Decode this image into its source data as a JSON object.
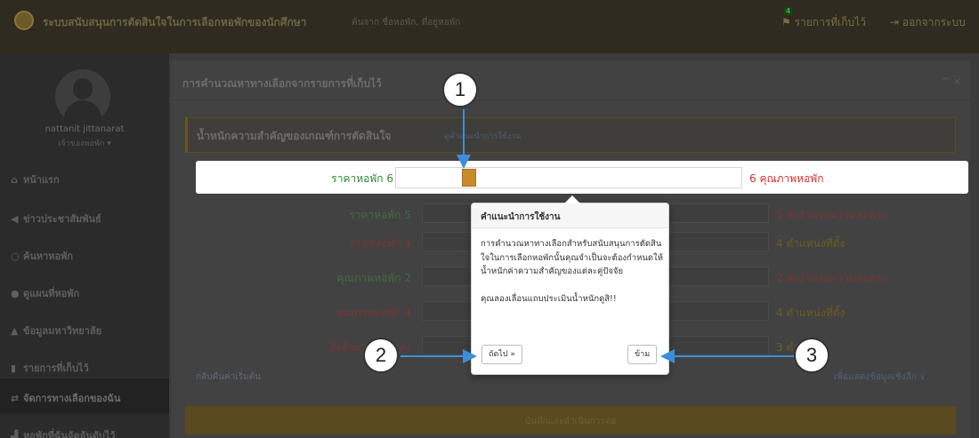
{
  "header": {
    "title": "ระบบสนับสนุนการตัดสินใจในการเลือกหอพักของนักศึกษา",
    "subtitle": "ค้นจาก ชื่อหอพัก, ที่อยู่หอพัก",
    "saved_count": "4",
    "saved_label": "รายการที่เก็บไว้",
    "logout_label": "ออกจากระบบ"
  },
  "sidebar": {
    "user_name": "nattanit jittanarat",
    "user_role": "เจ้าของหอพัก ▾",
    "items": [
      {
        "label": "หน้าแรก",
        "icon": "home-icon"
      },
      {
        "label": "ข่าวประชาสัมพันธ์",
        "icon": "megaphone-icon"
      },
      {
        "label": "ค้นหาหอพัก",
        "icon": "search-icon"
      },
      {
        "label": "ดูแผนที่หอพัก",
        "icon": "map-marker-icon"
      },
      {
        "label": "ข้อมูลมหาวิทยาลัย",
        "icon": "graduation-cap-icon"
      },
      {
        "label": "รายการที่เก็บไว้",
        "icon": "bookmark-icon"
      },
      {
        "label": "จัดการทางเลือกของฉัน",
        "icon": "exchange-icon"
      },
      {
        "label": "หอพักที่ฉันจัดอันดับไว้",
        "icon": "bar-chart-icon"
      }
    ]
  },
  "panel": {
    "title": "การคำนวณหาทางเลือกจากรายการที่เก็บไว้",
    "controls": "^ ×",
    "weights_label": "น้ำหนักความสำคัญของเกณฑ์การตัดสินใจ",
    "weights_link": "ดูคำแนะนำการใช้งาน",
    "highlight_row": {
      "left": "ราคาหอพัก 6",
      "right": "6 คุณภาพหอพัก",
      "level": 0.2
    },
    "rows": [
      {
        "left": "ราคาหอพัก 5",
        "right": "5 สิ่งอำนวยความสะดวก",
        "lcolor": "g",
        "rcolor": "r"
      },
      {
        "left": "ราคาหอพัก 4",
        "right": "4 ตำแหน่งที่ตั้ง",
        "lcolor": "r",
        "rcolor": "g"
      },
      {
        "left": "คุณภาพหอพัก 2",
        "right": "2 สิ่งอำนวยความสะดวก",
        "lcolor": "g",
        "rcolor": "r"
      },
      {
        "left": "คุณภาพหอพัก 4",
        "right": "4 ตำแหน่งที่ตั้ง",
        "lcolor": "r",
        "rcolor": "g"
      },
      {
        "left": "สิ่งอำนวยความสะ",
        "right": "3 ตำแหน่",
        "lcolor": "r",
        "rcolor": "g"
      }
    ],
    "reset_label": "กลับคืนค่าเริ่มต้น",
    "more_label": "เพื่อแสดงข้อมูลเชิงลึก ∨",
    "save_label": "บันทึกและดำเนินการต่อ"
  },
  "popover": {
    "title": "คำแนะนำการใช้งาน",
    "body1": "การคำนวณหาทางเลือกสำหรับสนับสนุนการตัดสินใจในการเลือกหอพักนั้นคุณจำเป็นจะต้องกำหนดให้น้ำหนักค่าความสำคัญของแต่ละคู่ปัจจัย",
    "body2": "คุณลองเลื่อนแถบประเมินน้ำหนักดูสิ!!",
    "next_label": "ถัดไป »",
    "skip_label": "ข้าม"
  },
  "annotations": {
    "c1": "1",
    "c2": "2",
    "c3": "3"
  },
  "colors": {
    "accent": "#c98b2a",
    "green": "#2e8b2e",
    "red": "#d9302c",
    "arrow": "#3b8fd9"
  }
}
